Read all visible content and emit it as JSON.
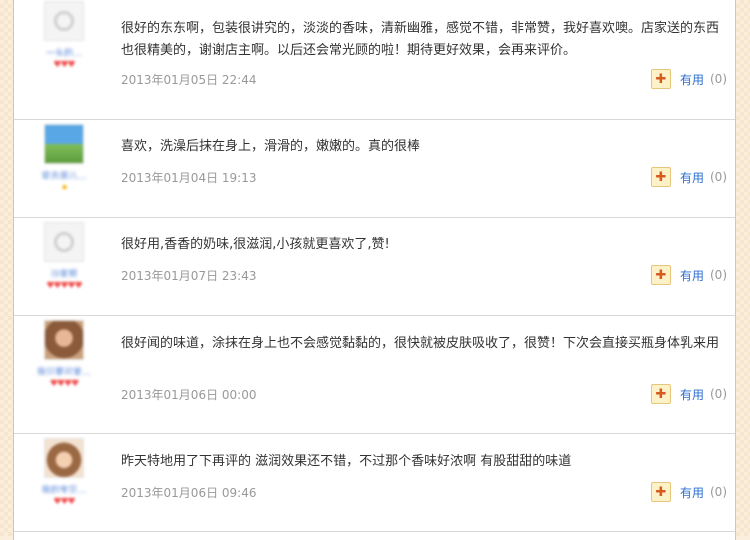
{
  "reviews": [
    {
      "username": "一头的…",
      "rating": "♥♥♥",
      "content": "很好的东东啊，包装很讲究的，淡淡的香味，清新幽雅，感觉不错，非常赞，我好喜欢噢。店家送的东西也很精美的，谢谢店主啊。以后还会常光顾的啦！期待更好效果，会再来评价。",
      "date": "2013年01月05日 22:44",
      "useful_label": "有用",
      "useful_count": "(0)"
    },
    {
      "username": "奕念哥儿…",
      "rating": "★",
      "content": "喜欢，洗澡后抹在身上，滑滑的，嫩嫩的。真的很棒",
      "date": "2013年01月04日 19:13",
      "useful_label": "有用",
      "useful_count": "(0)"
    },
    {
      "username": "沙家帮",
      "rating": "♥♥♥♥♥",
      "content": "很好用,香香的奶味,很滋润,小孩就更喜欢了,赞!",
      "date": "2013年01月07日 23:43",
      "useful_label": "有用",
      "useful_count": "(0)"
    },
    {
      "username": "我只要可爱…",
      "rating": "♥♥♥♥",
      "content": "很好闻的味道，涂抹在身上也不会感觉黏黏的，很快就被皮肤吸收了，很赞！下次会直接买瓶身体乳来用",
      "date": "2013年01月06日 00:00",
      "useful_label": "有用",
      "useful_count": "(0)"
    },
    {
      "username": "我的宝贝…",
      "rating": "♥♥♥",
      "content": "昨天特地用了下再评的 滋润效果还不错，不过那个香味好浓啊 有股甜甜的味道",
      "date": "2013年01月06日 09:46",
      "useful_label": "有用",
      "useful_count": "(0)"
    }
  ],
  "colors": {
    "background": "#fbeedc",
    "link": "#2c6fd0",
    "date": "#999999",
    "hearts": "#f05050",
    "divider": "#d8d8d8"
  },
  "icons": {
    "avatar_placeholder": "user-placeholder-icon",
    "gift": "gift-icon"
  }
}
